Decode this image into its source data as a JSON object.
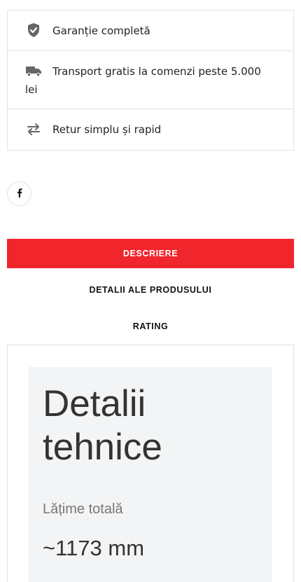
{
  "features": [
    {
      "icon": "shield-check-icon",
      "text": "Garanție completă"
    },
    {
      "icon": "truck-icon",
      "text": "Transport gratis la comenzi peste 5.000 lei"
    },
    {
      "icon": "swap-arrows-icon",
      "text": "Retur simplu și rapid"
    }
  ],
  "social": {
    "icon": "facebook-icon",
    "label": "f"
  },
  "tabs": [
    {
      "label": "DESCRIERE",
      "active": true
    },
    {
      "label": "DETALII ALE PRODUSULUI",
      "active": false
    },
    {
      "label": "RATING",
      "active": false
    }
  ],
  "panel": {
    "title": "Detalii tehnice",
    "spec_label": "Lățime totală",
    "spec_value": "~1173 mm"
  },
  "colors": {
    "accent": "#f0262c",
    "icon": "#666666",
    "border": "#e3e3e3"
  }
}
